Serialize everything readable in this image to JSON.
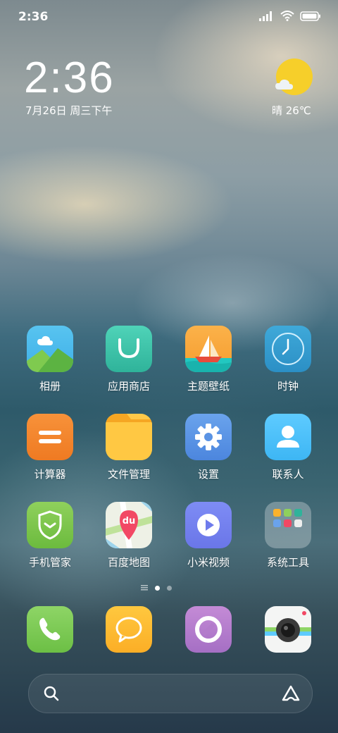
{
  "status_bar": {
    "time": "2:36"
  },
  "clock": {
    "time": "2:36",
    "date": "7月26日 周三下午"
  },
  "weather": {
    "text": "晴 26℃",
    "sun_color": "#f6cf2a"
  },
  "apps_row1": [
    "相册",
    "应用商店",
    "主题壁纸",
    "时钟"
  ],
  "apps_row2": [
    "计算器",
    "文件管理",
    "设置",
    "联系人"
  ],
  "apps_row3": [
    "手机管家",
    "百度地图",
    "小米视频",
    "系统工具"
  ],
  "map_badge": "du",
  "page_indicator": {
    "current": 1,
    "total": 2
  },
  "dock": [
    "phone-icon",
    "messages-icon",
    "browser-icon",
    "camera-icon"
  ]
}
